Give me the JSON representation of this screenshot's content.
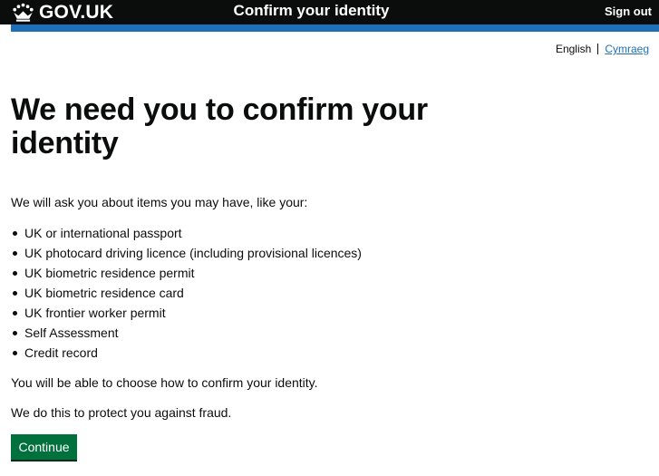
{
  "header": {
    "logo_text": "GOV.UK",
    "logo_icon": "crown-icon",
    "service_name": "Confirm your identity",
    "sign_out_label": "Sign out",
    "background_color": "#0b0c0c",
    "rule_color": "#1d70b8"
  },
  "language": {
    "current": "English",
    "alternative": "Cymraeg"
  },
  "main": {
    "heading": "We need you to confirm your identity",
    "intro": "We will ask you about items you may have, like your:",
    "items": [
      "UK or international passport",
      "UK photocard driving licence (including provisional licences)",
      "UK biometric residence permit",
      "UK biometric residence card",
      "UK frontier worker permit",
      "Self Assessment",
      "Credit record"
    ],
    "choose_text": "You will be able to choose how to confirm your identity.",
    "protect_text": "We do this to protect you against fraud.",
    "continue_label": "Continue",
    "button_color": "#00703c",
    "link_color": "#1d70b8"
  }
}
